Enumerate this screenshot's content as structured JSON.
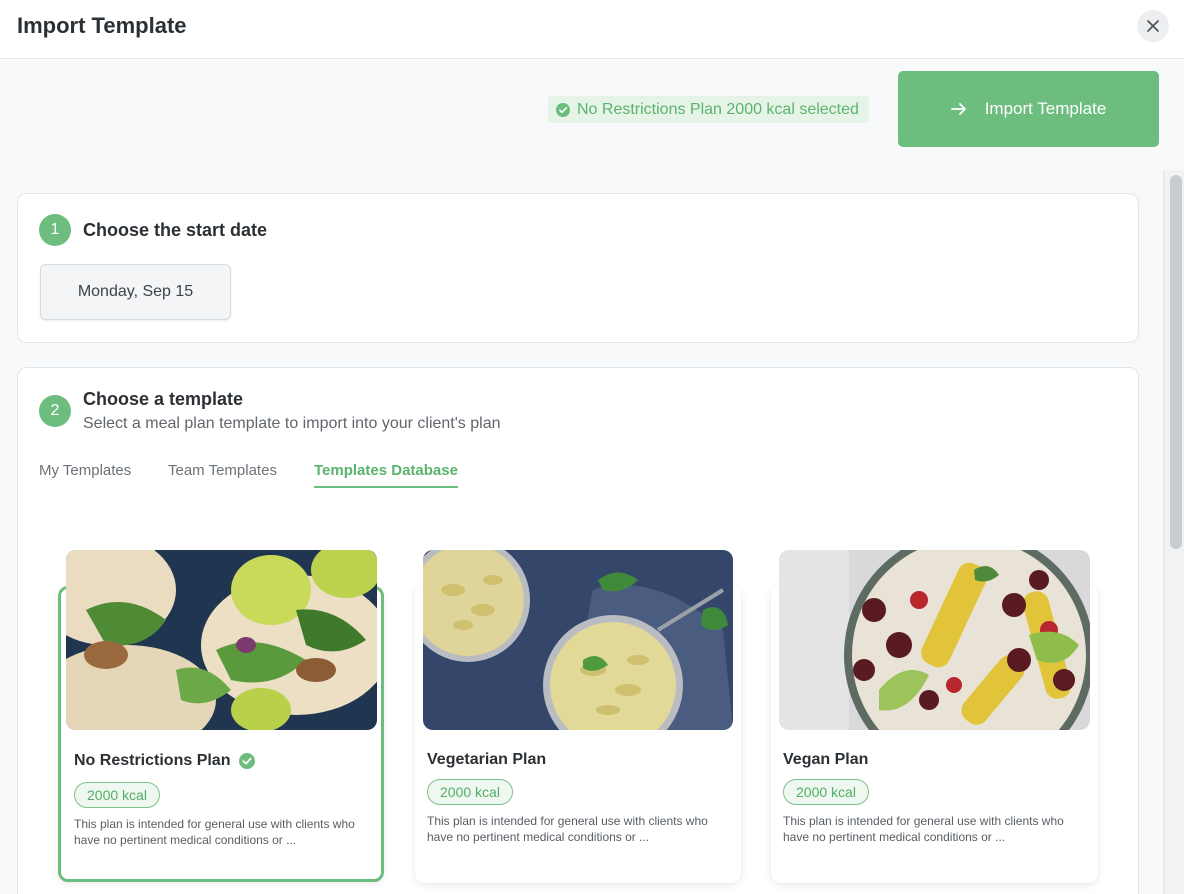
{
  "header": {
    "title": "Import Template"
  },
  "actions": {
    "selected_text": "No Restrictions Plan 2000 kcal selected",
    "import_label": "Import Template"
  },
  "step1": {
    "number": "1",
    "title": "Choose the start date",
    "date": "Monday, Sep 15"
  },
  "step2": {
    "number": "2",
    "title": "Choose a template",
    "subtitle": "Select a meal plan template to import into your client's plan",
    "tabs": [
      {
        "label": "My Templates"
      },
      {
        "label": "Team Templates"
      },
      {
        "label": "Templates Database",
        "active": true
      }
    ]
  },
  "templates": [
    {
      "name": "No Restrictions Plan",
      "kcal": "2000 kcal",
      "description": "This plan is intended for general use with clients who have no pertinent medical conditions or ...",
      "selected": true
    },
    {
      "name": "Vegetarian Plan",
      "kcal": "2000 kcal",
      "description": "This plan is intended for general use with clients who have no pertinent medical conditions or ...",
      "selected": false
    },
    {
      "name": "Vegan Plan",
      "kcal": "2000 kcal",
      "description": "This plan is intended for general use with clients who have no pertinent medical conditions or ...",
      "selected": false
    }
  ],
  "colors": {
    "accent": "#6cbd7e",
    "accent_text": "#5bb36d",
    "accent_bg": "#e6f4e8"
  },
  "icons": [
    "close-icon",
    "check-circle-icon",
    "arrow-right-icon"
  ]
}
